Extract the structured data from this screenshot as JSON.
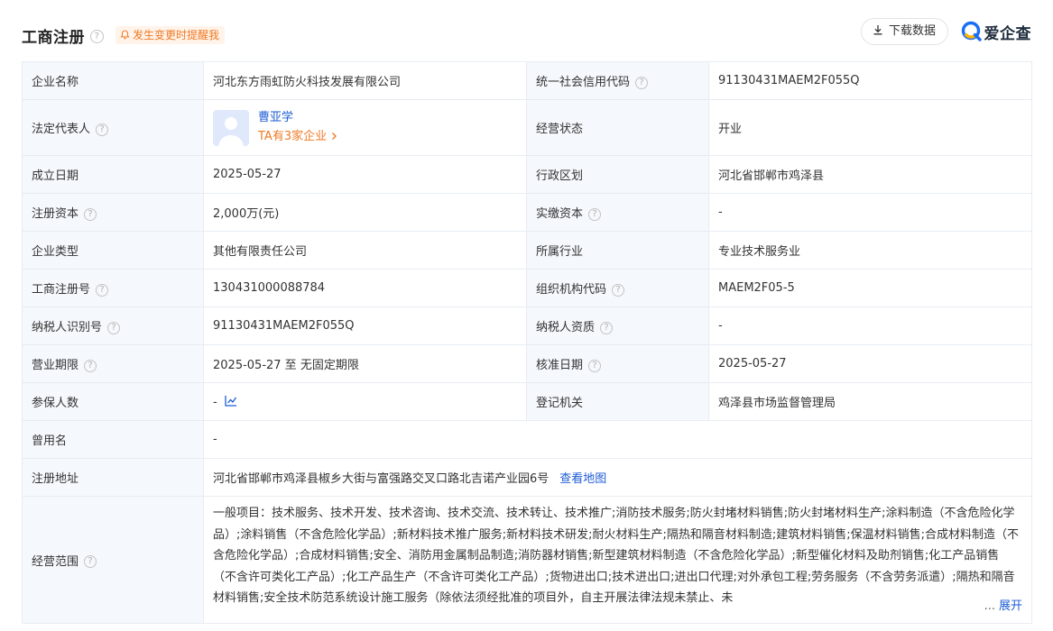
{
  "header": {
    "title": "工商注册",
    "reminder": "发生变更时提醒我",
    "download_label": "下载数据",
    "brand": "爱企查"
  },
  "rows": [
    {
      "k1": "企业名称",
      "v1": "河北东方雨虹防火科技发展有限公司",
      "k2": "统一社会信用代码",
      "v2": "91130431MAEM2F055Q"
    },
    {
      "k1": "法定代表人",
      "v1_name": "曹亚学",
      "v1_link": "TA有3家企业",
      "k2": "经营状态",
      "v2": "开业"
    },
    {
      "k1": "成立日期",
      "v1": "2025-05-27",
      "k2": "行政区划",
      "v2": "河北省邯郸市鸡泽县"
    },
    {
      "k1": "注册资本",
      "v1": "2,000万(元)",
      "k2": "实缴资本",
      "v2": "-"
    },
    {
      "k1": "企业类型",
      "v1": "其他有限责任公司",
      "k2": "所属行业",
      "v2": "专业技术服务业"
    },
    {
      "k1": "工商注册号",
      "v1": "130431000088784",
      "k2": "组织机构代码",
      "v2": "MAEM2F05-5"
    },
    {
      "k1": "纳税人识别号",
      "v1": "91130431MAEM2F055Q",
      "k2": "纳税人资质",
      "v2": "-"
    },
    {
      "k1": "营业期限",
      "v1": "2025-05-27 至 无固定期限",
      "k2": "核准日期",
      "v2": "2025-05-27"
    },
    {
      "k1": "参保人数",
      "v1": "-",
      "k2": "登记机关",
      "v2": "鸡泽县市场监督管理局"
    }
  ],
  "former_name": {
    "k": "曾用名",
    "v": "-"
  },
  "address": {
    "k": "注册地址",
    "v": "河北省邯郸市鸡泽县椒乡大街与富强路交叉口路北吉诺产业园6号",
    "link": "查看地图"
  },
  "scope": {
    "k": "经营范围",
    "v": "一般项目：技术服务、技术开发、技术咨询、技术交流、技术转让、技术推广;消防技术服务;防火封堵材料销售;防火封堵材料生产;涂料制造（不含危险化学品）;涂料销售（不含危险化学品）;新材料技术推广服务;新材料技术研发;耐火材料生产;隔热和隔音材料制造;建筑材料销售;保温材料销售;合成材料制造（不含危险化学品）;合成材料销售;安全、消防用金属制品制造;消防器材销售;新型建筑材料制造（不含危险化学品）;新型催化材料及助剂销售;化工产品销售（不含许可类化工产品）;化工产品生产（不含许可类化工产品）;货物进出口;技术进出口;进出口代理;对外承包工程;劳务服务（不含劳务派遣）;隔热和隔音材料销售;安全技术防范系统设计施工服务（除依法须经批准的项目外，自主开展法律法规未禁止、未",
    "ellipsis": "...",
    "more": "展开"
  }
}
